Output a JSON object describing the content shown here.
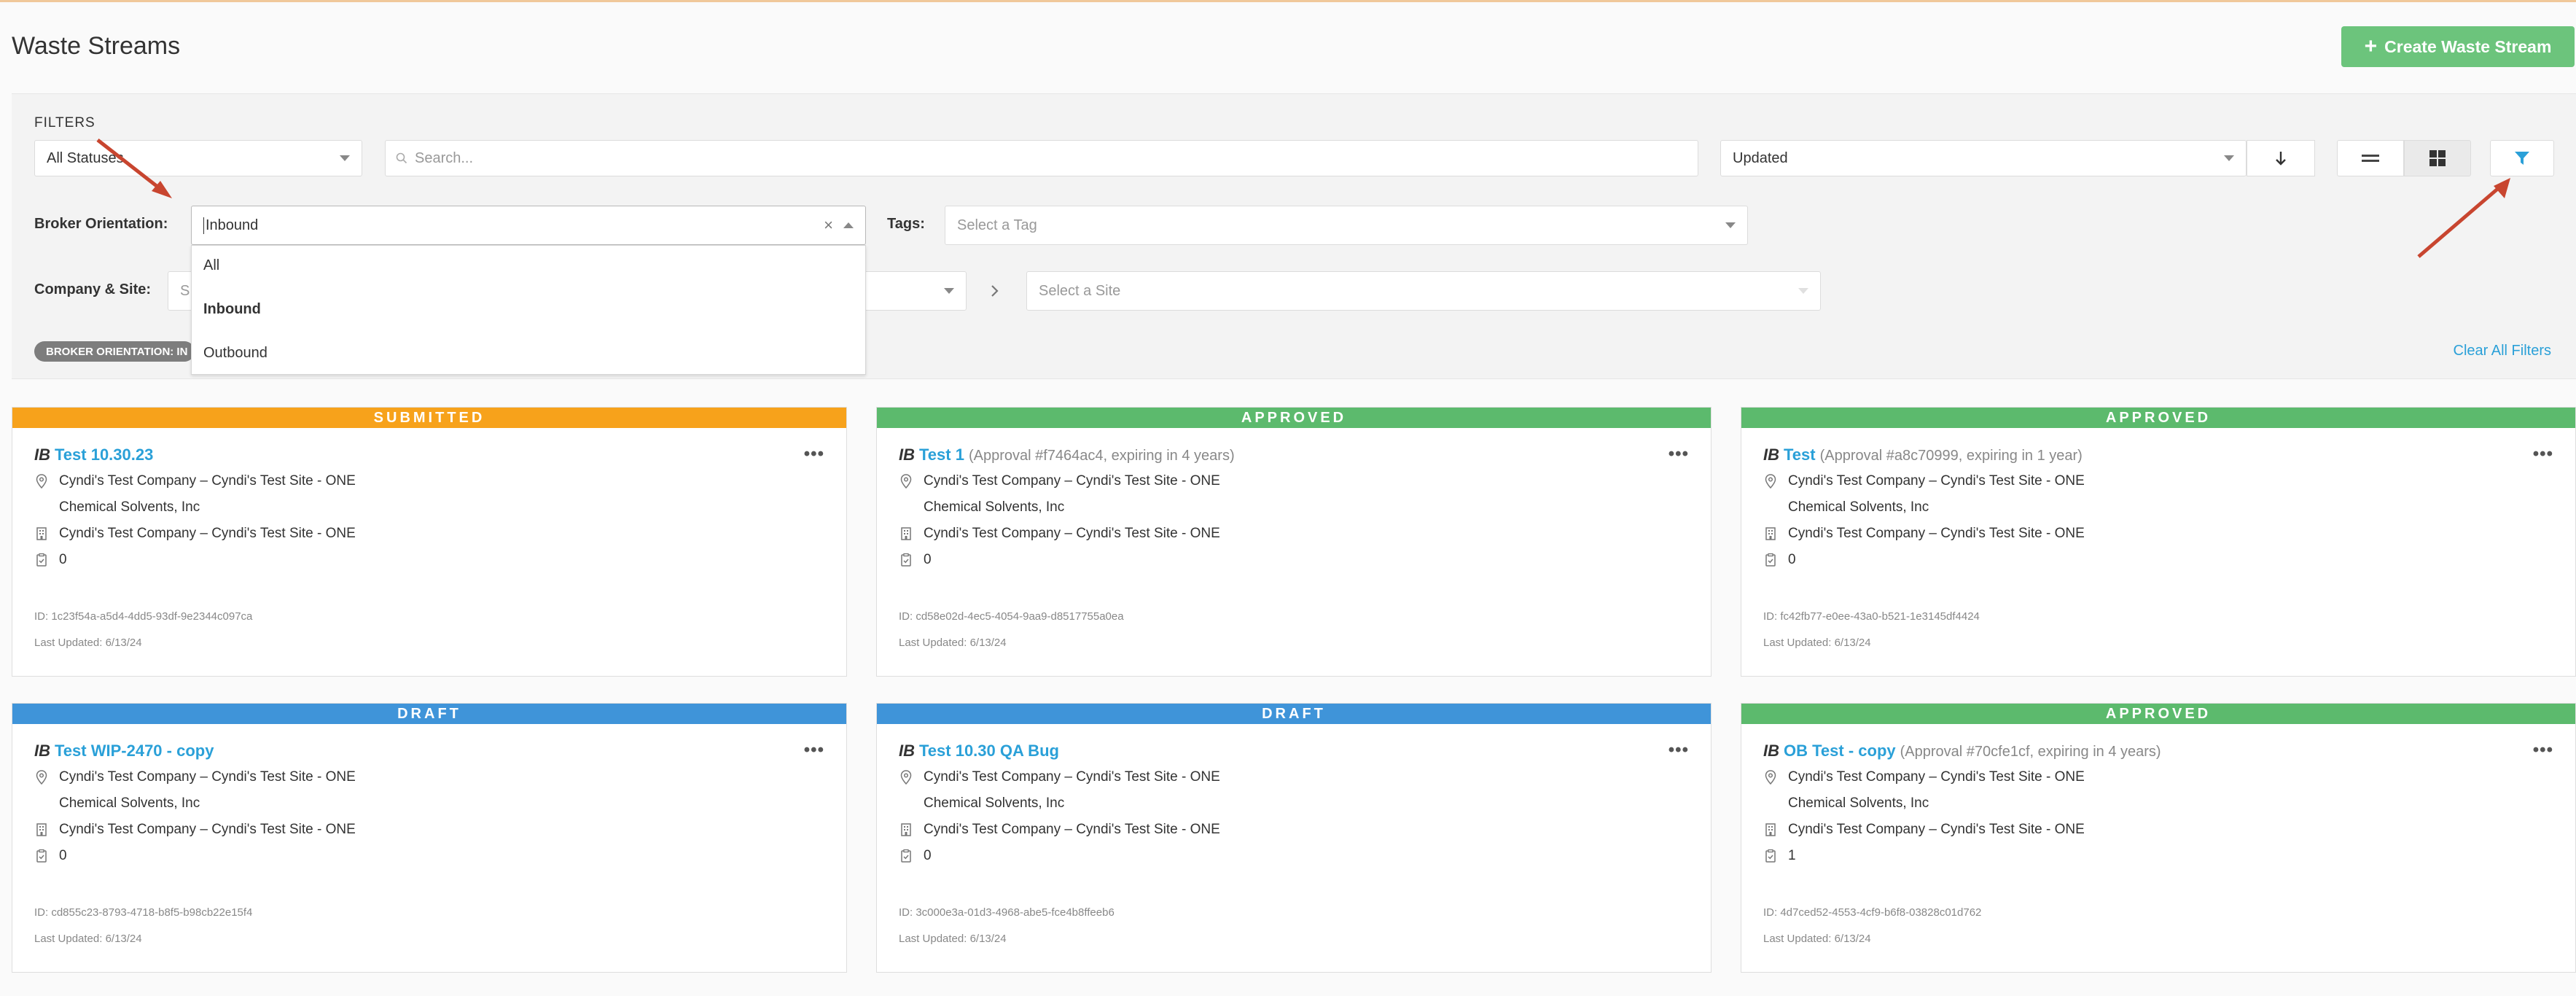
{
  "page": {
    "title": "Waste Streams",
    "create_button": "Create Waste Stream"
  },
  "filters": {
    "label": "FILTERS",
    "status_select": "All Statuses",
    "search_placeholder": "Search...",
    "sort_select": "Updated",
    "broker_orientation_label": "Broker Orientation:",
    "broker_orientation_value": "Inbound",
    "broker_orientation_options": [
      "All",
      "Inbound",
      "Outbound"
    ],
    "tags_label": "Tags:",
    "tags_placeholder": "Select a Tag",
    "company_site_label": "Company & Site:",
    "company_placeholder": "S",
    "site_placeholder": "Select a Site",
    "active_chip": "BROKER ORIENTATION: IN",
    "clear_all": "Clear All Filters"
  },
  "cards": [
    {
      "status": "SUBMITTED",
      "prefix": "IB",
      "name": "Test 10.30.23",
      "approval": "",
      "location": "Cyndi's Test Company – Cyndi's Test Site - ONE",
      "vendor": "Chemical Solvents, Inc",
      "generator": "Cyndi's Test Company – Cyndi's Test Site - ONE",
      "count": "0",
      "id": "ID: 1c23f54a-a5d4-4dd5-93df-9e2344c097ca",
      "updated": "Last Updated: 6/13/24"
    },
    {
      "status": "APPROVED",
      "prefix": "IB",
      "name": "Test 1",
      "approval": "(Approval #f7464ac4, expiring in 4 years)",
      "location": "Cyndi's Test Company – Cyndi's Test Site - ONE",
      "vendor": "Chemical Solvents, Inc",
      "generator": "Cyndi's Test Company – Cyndi's Test Site - ONE",
      "count": "0",
      "id": "ID: cd58e02d-4ec5-4054-9aa9-d8517755a0ea",
      "updated": "Last Updated: 6/13/24"
    },
    {
      "status": "APPROVED",
      "prefix": "IB",
      "name": "Test",
      "approval": "(Approval #a8c70999, expiring in 1 year)",
      "location": "Cyndi's Test Company – Cyndi's Test Site - ONE",
      "vendor": "Chemical Solvents, Inc",
      "generator": "Cyndi's Test Company – Cyndi's Test Site - ONE",
      "count": "0",
      "id": "ID: fc42fb77-e0ee-43a0-b521-1e3145df4424",
      "updated": "Last Updated: 6/13/24"
    },
    {
      "status": "DRAFT",
      "prefix": "IB",
      "name": "Test WIP-2470 - copy",
      "approval": "",
      "location": "Cyndi's Test Company – Cyndi's Test Site - ONE",
      "vendor": "Chemical Solvents, Inc",
      "generator": "Cyndi's Test Company – Cyndi's Test Site - ONE",
      "count": "0",
      "id": "ID: cd855c23-8793-4718-b8f5-b98cb22e15f4",
      "updated": "Last Updated: 6/13/24"
    },
    {
      "status": "DRAFT",
      "prefix": "IB",
      "name": "Test 10.30 QA Bug",
      "approval": "",
      "location": "Cyndi's Test Company – Cyndi's Test Site - ONE",
      "vendor": "Chemical Solvents, Inc",
      "generator": "Cyndi's Test Company – Cyndi's Test Site - ONE",
      "count": "0",
      "id": "ID: 3c000e3a-01d3-4968-abe5-fce4b8ffeeb6",
      "updated": "Last Updated: 6/13/24"
    },
    {
      "status": "APPROVED",
      "prefix": "IB",
      "name": "OB Test - copy",
      "approval": "(Approval #70cfe1cf, expiring in 4 years)",
      "location": "Cyndi's Test Company – Cyndi's Test Site - ONE",
      "vendor": "Chemical Solvents, Inc",
      "generator": "Cyndi's Test Company – Cyndi's Test Site - ONE",
      "count": "1",
      "id": "ID: 4d7ced52-4553-4cf9-b6f8-03828c01d762",
      "updated": "Last Updated: 6/13/24"
    }
  ],
  "colors": {
    "submitted": "#f7a21b",
    "approved": "#5cba6d",
    "draft": "#3f94d9",
    "link": "#2aa0d8",
    "create_button": "#6cc47c",
    "annotation_arrow": "#c8452f"
  },
  "icons": {
    "location": "map-pin-icon",
    "generator": "building-icon",
    "count": "clipboard-icon",
    "menu": "more-icon",
    "filter": "funnel-icon",
    "list_view": "list-view-icon",
    "grid_view": "grid-view-icon",
    "sort": "arrow-down-icon"
  }
}
